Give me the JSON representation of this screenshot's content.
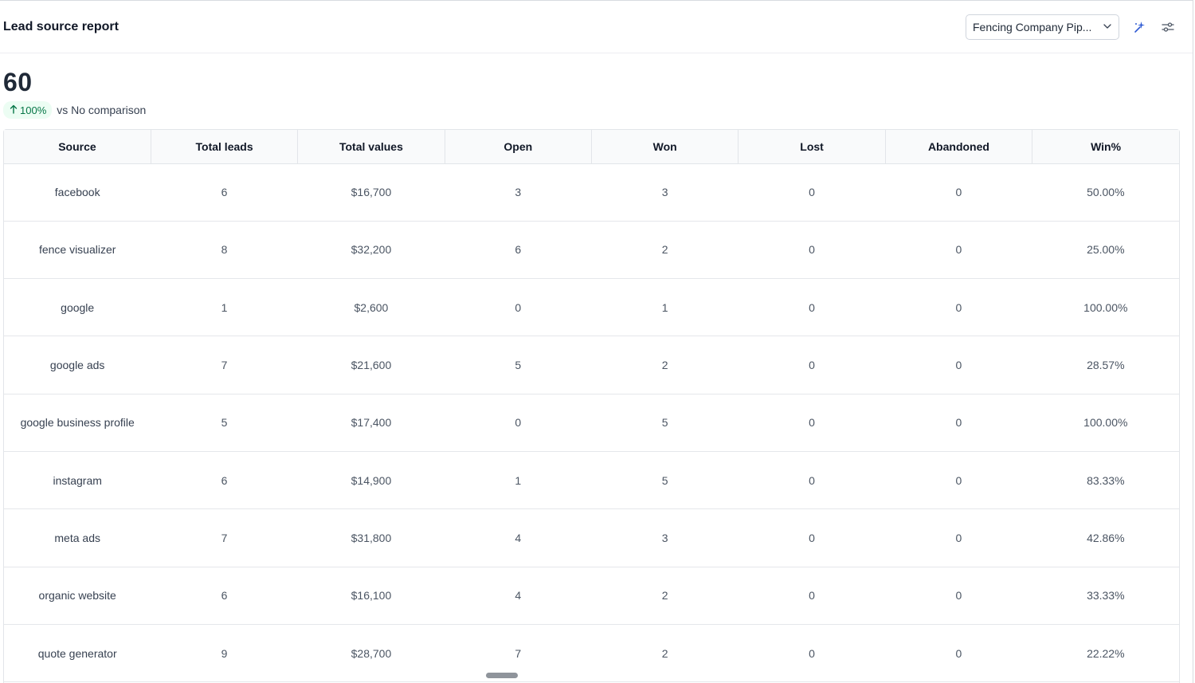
{
  "header": {
    "title": "Lead source report",
    "pipeline_select": "Fencing Company Pip...",
    "icons": [
      "chevron-down-icon",
      "sparkle-icon",
      "filter-settings-icon"
    ]
  },
  "summary": {
    "total": "60",
    "delta": "100%",
    "delta_direction": "up",
    "comparison": "vs No comparison"
  },
  "colors": {
    "accent": "#2f5bd3",
    "positive_bg": "#ecfdf3",
    "positive_text": "#067647"
  },
  "table": {
    "columns": [
      "Source",
      "Total leads",
      "Total values",
      "Open",
      "Won",
      "Lost",
      "Abandoned",
      "Win%"
    ],
    "rows": [
      [
        "facebook",
        "6",
        "$16,700",
        "3",
        "3",
        "0",
        "0",
        "50.00%"
      ],
      [
        "fence visualizer",
        "8",
        "$32,200",
        "6",
        "2",
        "0",
        "0",
        "25.00%"
      ],
      [
        "google",
        "1",
        "$2,600",
        "0",
        "1",
        "0",
        "0",
        "100.00%"
      ],
      [
        "google ads",
        "7",
        "$21,600",
        "5",
        "2",
        "0",
        "0",
        "28.57%"
      ],
      [
        "google business profile",
        "5",
        "$17,400",
        "0",
        "5",
        "0",
        "0",
        "100.00%"
      ],
      [
        "instagram",
        "6",
        "$14,900",
        "1",
        "5",
        "0",
        "0",
        "83.33%"
      ],
      [
        "meta ads",
        "7",
        "$31,800",
        "4",
        "3",
        "0",
        "0",
        "42.86%"
      ],
      [
        "organic website",
        "6",
        "$16,100",
        "4",
        "2",
        "0",
        "0",
        "33.33%"
      ],
      [
        "quote generator",
        "9",
        "$28,700",
        "7",
        "2",
        "0",
        "0",
        "22.22%"
      ]
    ]
  }
}
